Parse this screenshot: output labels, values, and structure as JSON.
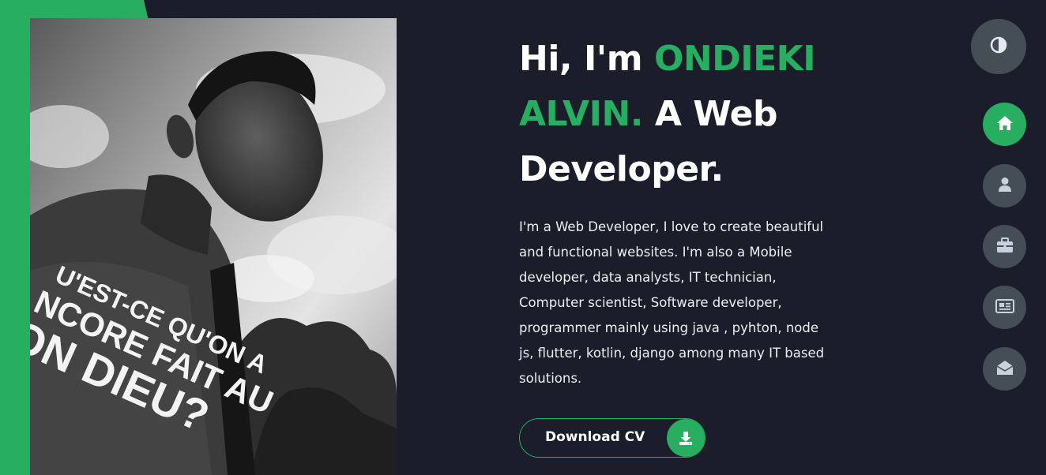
{
  "hero": {
    "greeting": "Hi, I'm ",
    "name": "ONDIEKI ALVIN.",
    "tagline": " A Web Developer.",
    "description": "I'm a Web Developer, I love to create beautiful and functional websites. I'm also a Mobile developer, data analysts, IT technician, Computer scientist, Software developer, programmer mainly using java , pyhton, node js, flutter, kotlin, django among many IT based solutions."
  },
  "portrait": {
    "shirt_text_line1": "U'EST-CE QU'ON A",
    "shirt_text_line2": "NCORE FAIT AU",
    "shirt_text_line3": "ON DIEU?"
  },
  "cv_button": {
    "label": "Download CV",
    "icon": "download-icon"
  },
  "theme_toggle": {
    "icon": "contrast-icon"
  },
  "nav": [
    {
      "id": "home",
      "icon": "home-icon",
      "active": true
    },
    {
      "id": "about",
      "icon": "user-icon",
      "active": false
    },
    {
      "id": "portfolio",
      "icon": "briefcase-icon",
      "active": false
    },
    {
      "id": "blogs",
      "icon": "newspaper-icon",
      "active": false
    },
    {
      "id": "contact",
      "icon": "envelope-open-icon",
      "active": false
    }
  ],
  "colors": {
    "accent": "#27ae60",
    "background": "#1b1e2a",
    "button_gray": "#454e56",
    "icon_light": "#c9d2dc",
    "text": "#ffffff"
  }
}
